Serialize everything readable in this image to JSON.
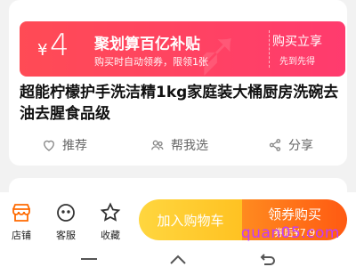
{
  "coupon": {
    "symbol": "¥",
    "amount": "4",
    "name": "聚划算百亿补贴",
    "rule": "购买时自动领券，限领1张",
    "buy_label": "购买立享",
    "buy_sub": "先到先得"
  },
  "product": {
    "title": "超能柠檬护手洗洁精1kg家庭装大桶厨房洗碗去油去腥食品级"
  },
  "actions": {
    "recommend": "推荐",
    "help_choose": "帮我选",
    "share": "分享"
  },
  "tabbar": {
    "store": "店铺",
    "service": "客服",
    "favorite": "收藏"
  },
  "buttons": {
    "add_to_cart": "加入购物车",
    "coupon_buy": "领券购买",
    "coupon_price": "券后¥7.9"
  },
  "watermark": "quan05.com",
  "colors": {
    "coupon_red": "#ff4b55",
    "cart_yellow": "#ffc222",
    "buy_orange": "#ff5a12",
    "store_icon": "#ff6a00"
  }
}
